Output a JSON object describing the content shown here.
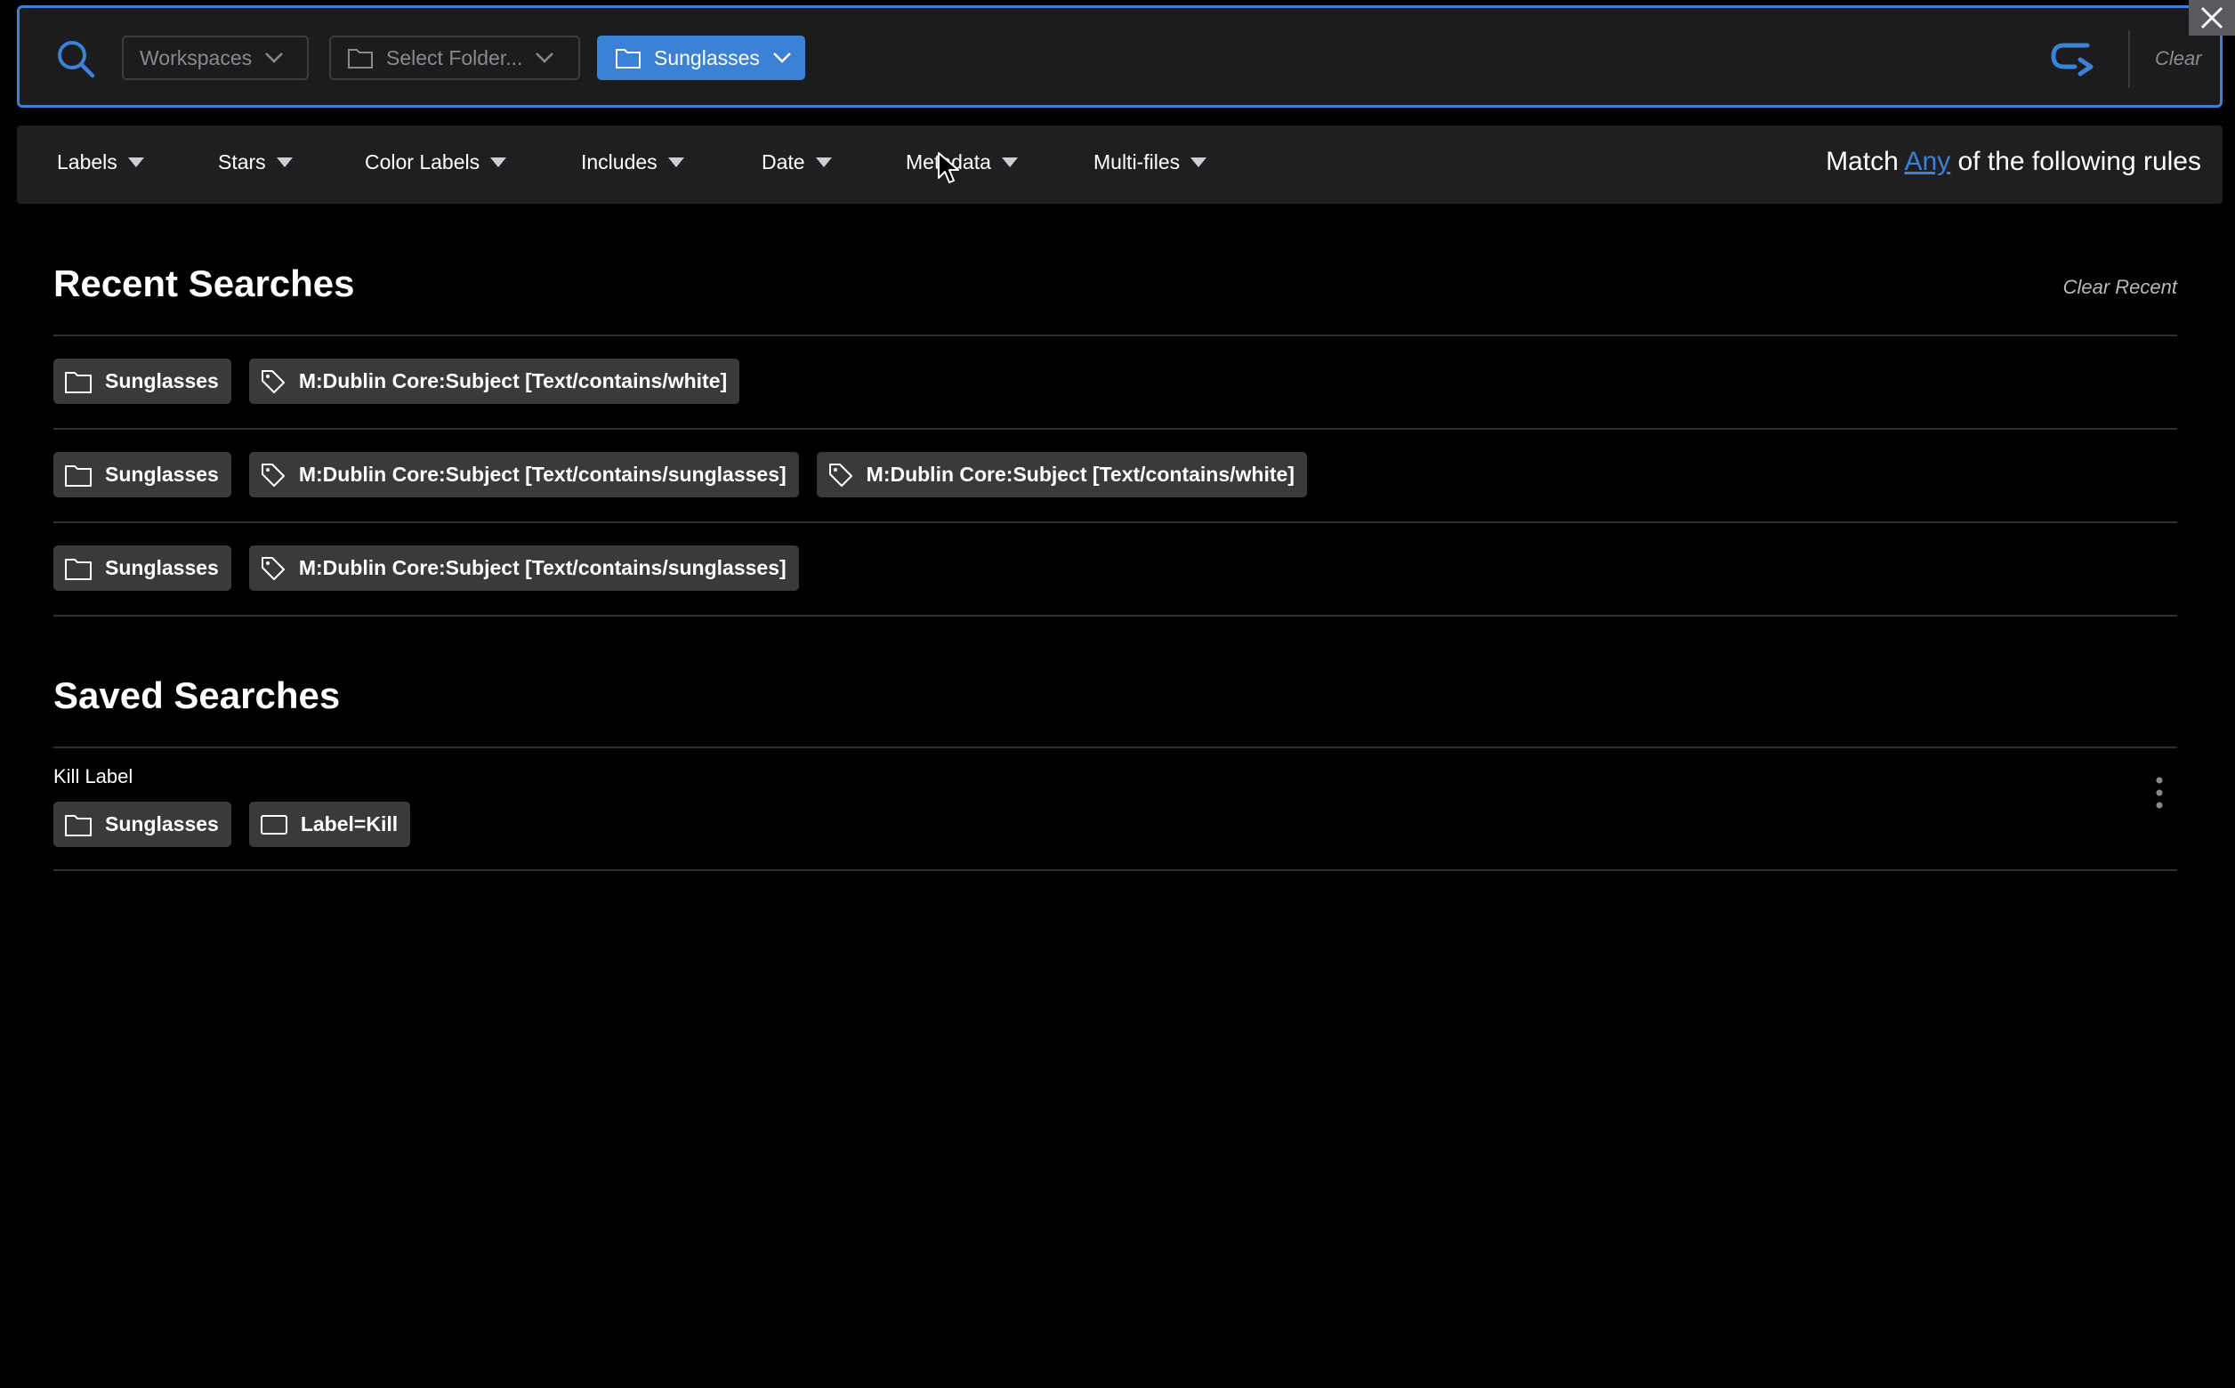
{
  "search_bar": {
    "workspaces_label": "Workspaces",
    "folder_placeholder": "Select Folder...",
    "active_folder_label": "Sunglasses",
    "clear_label": "Clear"
  },
  "filters": {
    "items": [
      "Labels",
      "Stars",
      "Color Labels",
      "Includes",
      "Date",
      "Metadata",
      "Multi-files"
    ],
    "match_prefix": "Match",
    "match_mode": "Any",
    "match_suffix": "of the following rules"
  },
  "recent": {
    "title": "Recent Searches",
    "clear_label": "Clear Recent",
    "rows": [
      {
        "folder": "Sunglasses",
        "rules": [
          "M:Dublin Core:Subject [Text/contains/white]"
        ]
      },
      {
        "folder": "Sunglasses",
        "rules": [
          "M:Dublin Core:Subject [Text/contains/sunglasses]",
          "M:Dublin Core:Subject [Text/contains/white]"
        ]
      },
      {
        "folder": "Sunglasses",
        "rules": [
          "M:Dublin Core:Subject [Text/contains/sunglasses]"
        ]
      }
    ]
  },
  "saved": {
    "title": "Saved Searches",
    "items": [
      {
        "name": "Kill Label",
        "folder": "Sunglasses",
        "rule": "Label=Kill"
      }
    ]
  },
  "colors": {
    "accent": "#3b82d6",
    "chip_bg": "#3a3a3c",
    "panel_bg": "#1f1f21"
  }
}
